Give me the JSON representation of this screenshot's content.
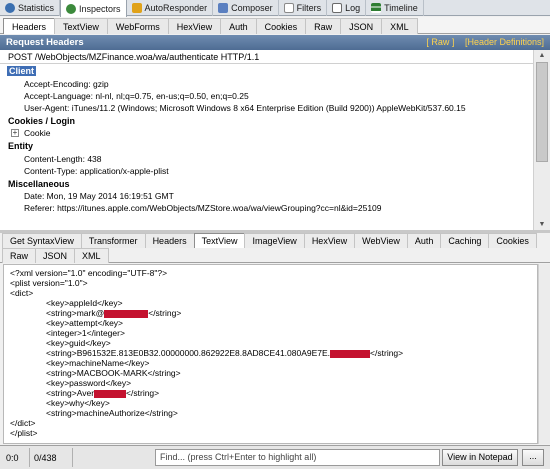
{
  "top_tabs": [
    {
      "label": "Statistics",
      "icon": "stopwatch-icon",
      "color": "#3a6fb0"
    },
    {
      "label": "Inspectors",
      "icon": "magnifier-icon",
      "color": "#3c8a3c"
    },
    {
      "label": "AutoResponder",
      "icon": "lightning-icon",
      "color": "#e0a21a"
    },
    {
      "label": "Composer",
      "icon": "pencil-icon",
      "color": "#5a7fc0"
    },
    {
      "label": "Filters",
      "icon": "checkbox-icon",
      "color": "#8a8a8a"
    },
    {
      "label": "Log",
      "icon": "document-icon",
      "color": "#6a6a6a"
    },
    {
      "label": "Timeline",
      "icon": "timeline-icon",
      "color": "#2e7d32"
    }
  ],
  "request_tabs": [
    "Headers",
    "TextView",
    "WebForms",
    "HexView",
    "Auth",
    "Cookies",
    "Raw",
    "JSON",
    "XML"
  ],
  "request_headers": {
    "title": "Request Headers",
    "raw_link": "[ Raw ]",
    "defs_link": "[Header Definitions]",
    "request_line": "POST /WebObjects/MZFinance.woa/wa/authenticate HTTP/1.1",
    "groups": [
      {
        "name": "Client",
        "lines": [
          "Accept-Encoding: gzip",
          "Accept-Language: nl-nl, nl;q=0.75, en-us;q=0.50, en;q=0.25",
          "User-Agent: iTunes/11.2 (Windows; Microsoft Windows 8 x64 Enterprise Edition (Build 9200)) AppleWebKit/537.60.15"
        ]
      },
      {
        "name": "Cookies / Login",
        "lines": [
          "Cookie"
        ]
      },
      {
        "name": "Entity",
        "lines": [
          "Content-Length: 438",
          "Content-Type: application/x-apple-plist"
        ]
      },
      {
        "name": "Miscellaneous",
        "lines": [
          "Date: Mon, 19 May 2014 16:19:51 GMT",
          "Referer: https://itunes.apple.com/WebObjects/MZStore.woa/wa/viewGrouping?cc=nl&id=25109"
        ]
      }
    ]
  },
  "response_tabs_row1": [
    "Get SyntaxView",
    "Transformer",
    "Headers",
    "TextView",
    "ImageView",
    "HexView",
    "WebView",
    "Auth",
    "Caching",
    "Cookies"
  ],
  "response_tabs_row2": [
    "Raw",
    "JSON",
    "XML"
  ],
  "xml_lines": [
    "<?xml version=\"1.0\" encoding=\"UTF-8\"?>",
    "<plist version=\"1.0\">",
    "<dict>",
    "<key>appleId</key>",
    "<string>mark@",
    "</string>",
    "<key>attempt</key>",
    "<integer>1</integer>",
    "<key>guid</key>",
    "<string>B961532E.813E0B32.00000000.862922E8.8AD8CE41.080A9E7E.",
    "</string>",
    "<key>machineName</key>",
    "<string>MACBOOK-MARK</string>",
    "<key>password</key>",
    "<string>Aver",
    "</string>",
    "<key>why</key>",
    "<string>machineAuthorize</string>",
    "</dict>",
    "</plist>"
  ],
  "status": {
    "position": "0:0",
    "length": "0/438",
    "find_text": "Find... (press Ctrl+Enter to highlight all)",
    "notepad_label": "View in Notepad",
    "ellipsis_label": "..."
  },
  "colors": {
    "redaction": "#c4122f",
    "selection": "#3f6eb5",
    "header_bar": "#5a789f",
    "link": "#ffd34d"
  }
}
